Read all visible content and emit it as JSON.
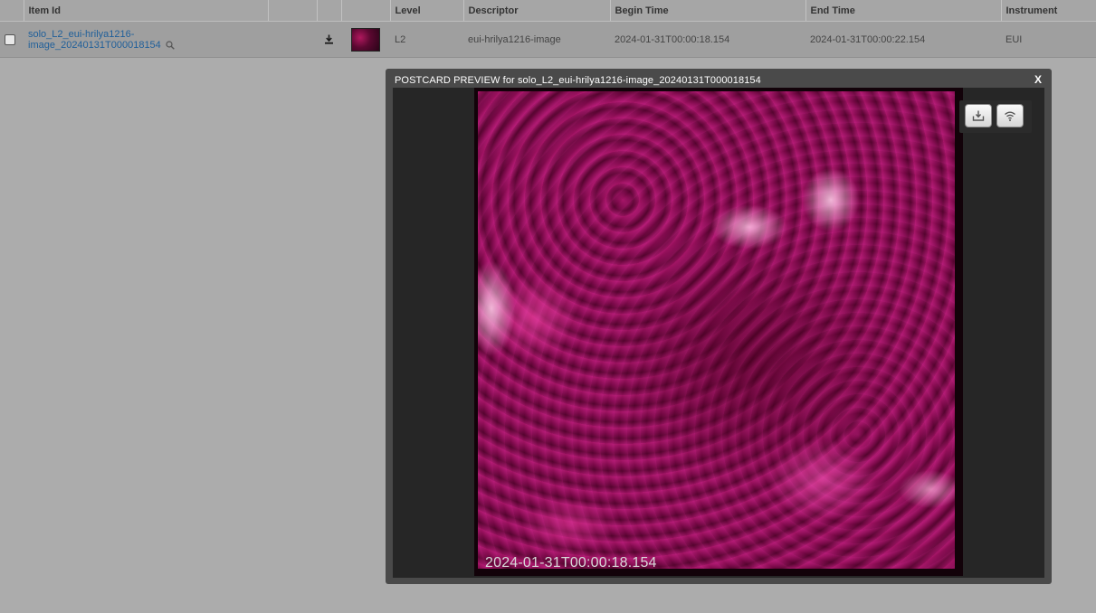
{
  "table": {
    "headers": {
      "item_id": "Item Id",
      "level": "Level",
      "descriptor": "Descriptor",
      "begin_time": "Begin Time",
      "end_time": "End Time",
      "instrument": "Instrument"
    },
    "row": {
      "item_id": "solo_L2_eui-hrilya1216-image_20240131T000018154",
      "level": "L2",
      "descriptor": "eui-hrilya1216-image",
      "begin_time": "2024-01-31T00:00:18.154",
      "end_time": "2024-01-31T00:00:22.154",
      "instrument": "EUI"
    }
  },
  "modal": {
    "title": "POSTCARD PREVIEW for solo_L2_eui-hrilya1216-image_20240131T000018154",
    "close_label": "X",
    "timestamp": "2024-01-31T00:00:18.154"
  },
  "icons": {
    "magnifier": "search-icon",
    "download": "download-icon",
    "thumbnail": "postcard-thumbnail",
    "save": "save-icon",
    "broadcast": "wifi-icon"
  },
  "colors": {
    "link": "#1f5f9a",
    "page_background": "#acacac",
    "modal_background": "#4a4a4a",
    "solar_tint": "#b0185e"
  }
}
